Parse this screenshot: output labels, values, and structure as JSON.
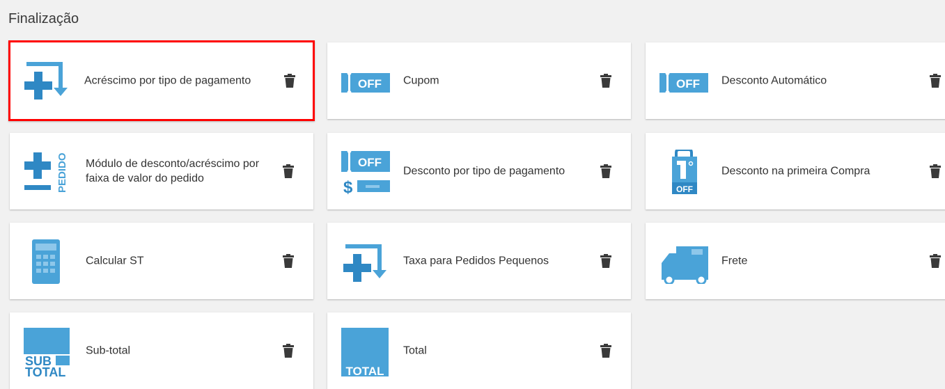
{
  "section": {
    "title": "Finalização"
  },
  "colors": {
    "icon_blue": "#4aa3d8",
    "icon_dark": "#2f88c4",
    "selected_border": "#ff0000",
    "trash": "#3a3a3a"
  },
  "cards": [
    {
      "label": "Acréscimo por tipo de pagamento",
      "icon": "plus-arrow-icon",
      "selected": true
    },
    {
      "label": "Cupom",
      "icon": "coupon-off-icon"
    },
    {
      "label": "Desconto Automático",
      "icon": "coupon-off-icon"
    },
    {
      "label": "Módulo de desconto/acréscimo por faixa de valor do pedido",
      "icon": "plus-minus-pedido-icon",
      "icon_text": "PEDIDO"
    },
    {
      "label": "Desconto por tipo de pagamento",
      "icon": "coupon-payment-icon",
      "icon_text": "OFF"
    },
    {
      "label": "Desconto na primeira Compra",
      "icon": "first-purchase-bag-icon",
      "icon_text": "OFF"
    },
    {
      "label": "Calcular ST",
      "icon": "calculator-icon"
    },
    {
      "label": "Taxa para Pedidos Pequenos",
      "icon": "plus-arrow-icon"
    },
    {
      "label": "Frete",
      "icon": "truck-icon"
    },
    {
      "label": "Sub-total",
      "icon": "subtotal-icon",
      "icon_text": [
        "SUB",
        "TOTAL"
      ]
    },
    {
      "label": "Total",
      "icon": "total-icon",
      "icon_text": "TOTAL"
    }
  ],
  "card_off_text": "OFF"
}
